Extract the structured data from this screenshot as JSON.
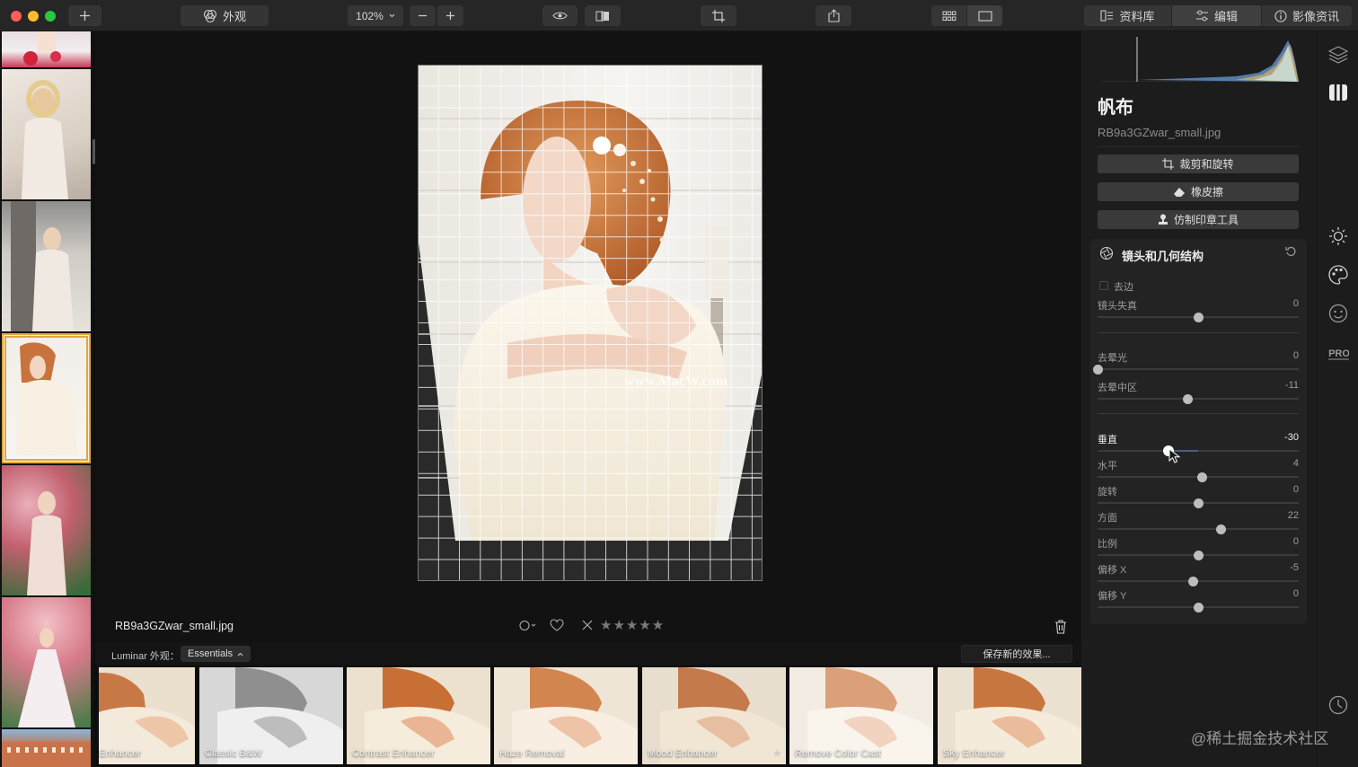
{
  "toolbar": {
    "looks_label": "外观",
    "zoom": "102%",
    "tabs": [
      "资料库",
      "编辑",
      "影像资讯"
    ]
  },
  "canvas": {
    "filename": "RB9a3GZwar_small.jpg",
    "watermark": "www.MacW.com",
    "stars": "★★★★★"
  },
  "looks_bar": {
    "label": "Luminar 外观：",
    "selected": "Essentials",
    "save_label": "保存新的效果..."
  },
  "looks": [
    {
      "name": "Enhancer"
    },
    {
      "name": "Classic B&W"
    },
    {
      "name": "Contrast Enhancer"
    },
    {
      "name": "Haze Removal"
    },
    {
      "name": "Mood Enhancer"
    },
    {
      "name": "Remove Color Cast"
    },
    {
      "name": "Sky Enhancer"
    }
  ],
  "panel": {
    "title": "帆布",
    "file": "RB9a3GZwar_small.jpg",
    "buttons": [
      "裁剪和旋转",
      "橡皮擦",
      "仿制印章工具"
    ],
    "section": {
      "title": "镜头和几何结构",
      "checkbox_label": "去边",
      "sliders": [
        {
          "label": "镜头失真",
          "value": "0",
          "level": 0.5
        },
        {
          "label": "去晕光",
          "value": "0",
          "level": 0.0
        },
        {
          "label": "去晕中区",
          "value": "-11",
          "level": 0.445
        },
        {
          "label": "垂直",
          "value": "-30",
          "level": 0.35
        },
        {
          "label": "水平",
          "value": "4",
          "level": 0.52
        },
        {
          "label": "旋转",
          "value": "0",
          "level": 0.5
        },
        {
          "label": "方面",
          "value": "22",
          "level": 0.61
        },
        {
          "label": "比例",
          "value": "0",
          "level": 0.5
        },
        {
          "label": "偏移 X",
          "value": "-5",
          "level": 0.475
        },
        {
          "label": "偏移 Y",
          "value": "0",
          "level": 0.5
        }
      ]
    }
  },
  "sidebar_badge": "PRO",
  "page_watermark": "@稀土掘金技术社区",
  "colors": {
    "accent_selected": "#e0a83a",
    "slider_fill": "#4b5d85"
  }
}
